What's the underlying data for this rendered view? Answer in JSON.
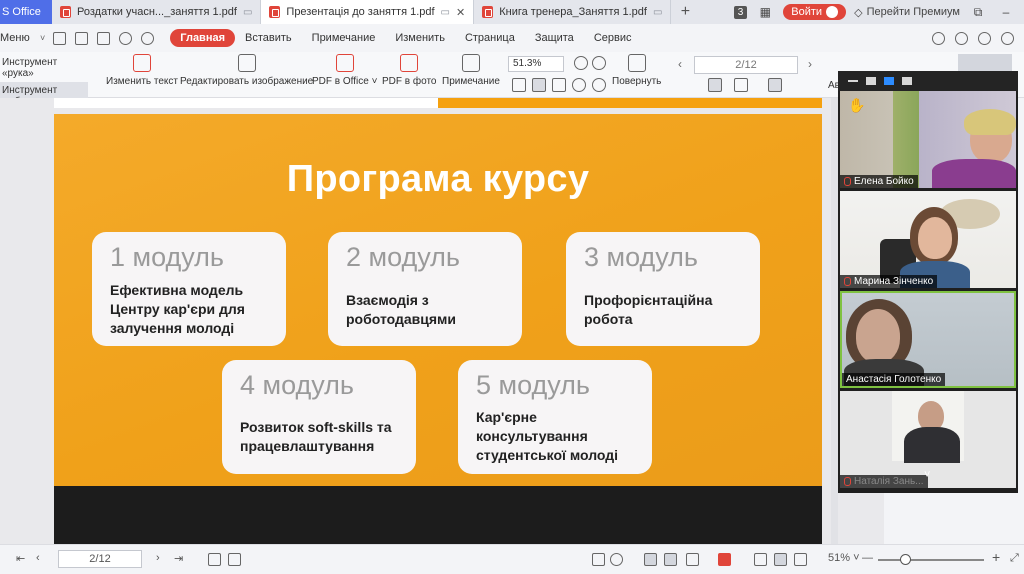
{
  "tabs": {
    "brand": "S Office",
    "items": [
      {
        "label": "Роздатки учасн..._заняття 1.pdf",
        "active": false
      },
      {
        "label": "Презентація до заняття 1.pdf",
        "active": true
      },
      {
        "label": "Книга тренера_Заняття 1.pdf",
        "active": false
      }
    ],
    "count_badge": "3",
    "login": "Войти",
    "premium": "Перейти Премиум"
  },
  "menu": {
    "menu_label": "Меню",
    "tabs": [
      "Главная",
      "Вставить",
      "Примечание",
      "Изменить",
      "Страница",
      "Защита",
      "Сервис"
    ],
    "active_tab": "Главная"
  },
  "toolbar": {
    "hand_tool": "Инструмент «рука»",
    "select_tool": "Инструмент выбора",
    "edit_text": "Изменить текст",
    "edit_image": "Редактировать изображение",
    "pdf_office": "PDF в Office ˅",
    "pdf_photo": "PDF в фото",
    "annotation": "Примечание",
    "zoom": "51.3%",
    "rotate": "Повернуть",
    "page_display": "2/12",
    "auto_label": "Ав"
  },
  "slide": {
    "title": "Програма курсу",
    "modules": [
      {
        "num": "1 модуль",
        "text": "Ефективна модель Центру кар'єри для залучення молоді"
      },
      {
        "num": "2 модуль",
        "text": "Взаємодія з роботодавцями"
      },
      {
        "num": "3 модуль",
        "text": "Профорієнтаційна робота"
      },
      {
        "num": "4 модуль",
        "text": "Розвиток soft-skills та працевлаштування"
      },
      {
        "num": "5 модуль",
        "text": "Кар'єрне консультування студентської молоді"
      }
    ]
  },
  "participants": [
    {
      "name": "Елена Бойко"
    },
    {
      "name": "Марина Зінченко"
    },
    {
      "name": "Анастасія Голотенко"
    },
    {
      "name": "Наталія Зань..."
    }
  ],
  "status": {
    "page": "2/12",
    "zoom": "51% ˅"
  },
  "colors": {
    "accent": "#e0453a",
    "slide_orange": "#f3a31c",
    "zoom_blue": "#2d8cff"
  }
}
